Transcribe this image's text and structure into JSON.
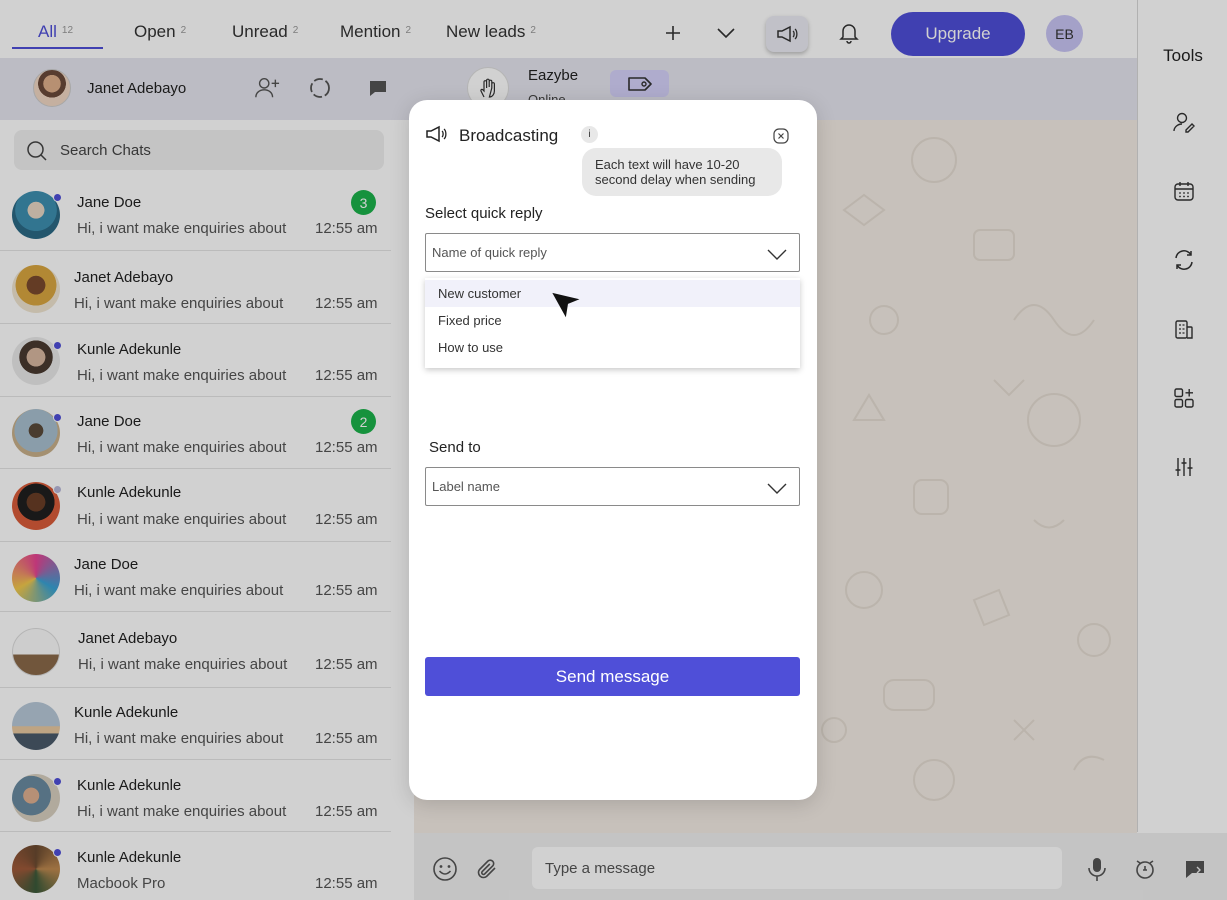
{
  "tabs": [
    {
      "label": "All",
      "count": "12"
    },
    {
      "label": "Open",
      "count": "2"
    },
    {
      "label": "Unread",
      "count": "2"
    },
    {
      "label": "Mention",
      "count": "2"
    },
    {
      "label": "New leads",
      "count": "2"
    }
  ],
  "header": {
    "upgrade_label": "Upgrade",
    "user_initials": "EB"
  },
  "tools": {
    "title": "Tools",
    "icons": [
      "user-edit-icon",
      "calendar-icon",
      "sync-icon",
      "building-icon",
      "add-widget-icon",
      "sliders-icon"
    ]
  },
  "profile": {
    "name": "Janet Adebayo"
  },
  "search": {
    "placeholder": "Search Chats"
  },
  "chats": [
    {
      "name": "Jane Doe",
      "preview": "Hi, i want make enquiries about",
      "time": "12:55 am",
      "unread": "3",
      "online": true
    },
    {
      "name": "Janet Adebayo",
      "preview": "Hi, i want make enquiries about",
      "time": "12:55 am",
      "unread": "",
      "online": false
    },
    {
      "name": "Kunle Adekunle",
      "preview": "Hi, i want make enquiries about",
      "time": "12:55 am",
      "unread": "",
      "online": true
    },
    {
      "name": "Jane Doe",
      "preview": "Hi, i want make enquiries about",
      "time": "12:55 am",
      "unread": "2",
      "online": true
    },
    {
      "name": "Kunle Adekunle",
      "preview": "Hi, i want make enquiries about",
      "time": "12:55 am",
      "unread": "",
      "online": true
    },
    {
      "name": "Jane Doe",
      "preview": "Hi, i want make enquiries about",
      "time": "12:55 am",
      "unread": "",
      "online": false
    },
    {
      "name": "Janet Adebayo",
      "preview": "Hi, i want make enquiries about",
      "time": "12:55 am",
      "unread": "",
      "online": false
    },
    {
      "name": "Kunle Adekunle",
      "preview": "Hi, i want make enquiries about",
      "time": "12:55 am",
      "unread": "",
      "online": false
    },
    {
      "name": "Kunle Adekunle",
      "preview": "Hi, i want make enquiries about",
      "time": "12:55 am",
      "unread": "",
      "online": true
    },
    {
      "name": "Kunle Adekunle",
      "preview": "Macbook Pro",
      "time": "12:55 am",
      "unread": "",
      "online": true
    }
  ],
  "conversation": {
    "contact_name": "Eazybe",
    "contact_status": "Online",
    "composer_placeholder": "Type a message"
  },
  "modal": {
    "title": "Broadcasting",
    "info_label": "i",
    "tooltip": "Each text will have 10-20 second delay when sending",
    "quick_reply_label": "Select quick reply",
    "quick_reply_placeholder": "Name of quick reply",
    "quick_reply_options": [
      "New customer",
      "Fixed price",
      "How to use"
    ],
    "send_to_label": "Send to",
    "send_to_placeholder": "Label name",
    "send_button": "Send message"
  },
  "colors": {
    "accent": "#4f4fd8",
    "badge_green": "#1bb24b",
    "online_dot": "#4f4fd8"
  }
}
